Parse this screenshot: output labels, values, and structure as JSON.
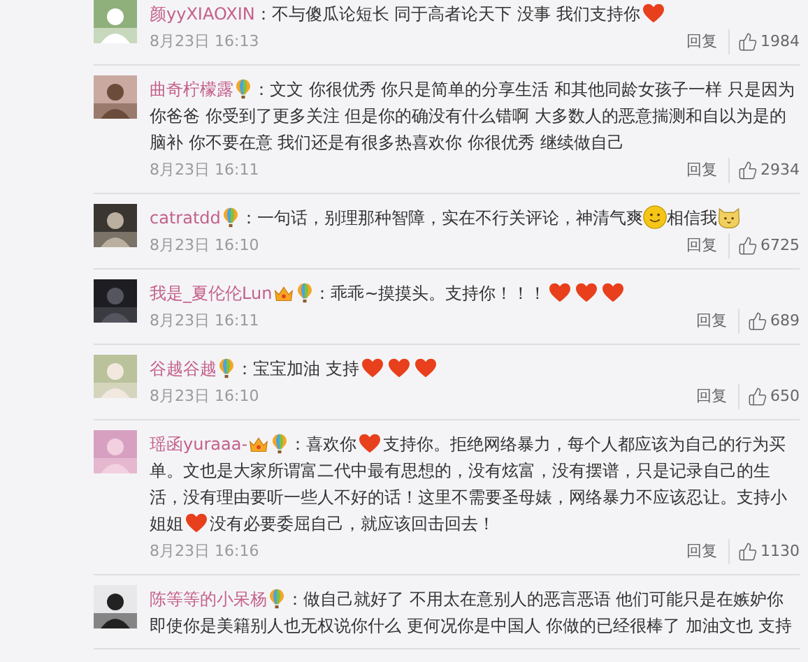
{
  "comments": [
    {
      "user": "颜yyXIAOXIN",
      "lines": [
        [
          {
            "kind": "text",
            "text": "：不与傻瓜论短长 同于高者论天下 没事 我们支持你"
          },
          {
            "kind": "heart"
          }
        ]
      ],
      "date": "8月23日 16:13",
      "reply": "回复",
      "likes": "1984"
    },
    {
      "user": "曲奇柠檬露",
      "badges": [
        {
          "kind": "balloon"
        }
      ],
      "lines": [
        [
          {
            "kind": "text",
            "text": "：文文 你很优秀 你只是简单的分享生活 和其他同龄女孩子一样 只是因为"
          }
        ],
        [
          {
            "kind": "text",
            "text": "你爸爸 你受到了更多关注 但是你的确没有什么错啊 大多数人的恶意揣测和自以为是的"
          }
        ],
        [
          {
            "kind": "text",
            "text": "脑补 你不要在意 我们还是有很多热喜欢你 你很优秀 继续做自己"
          }
        ]
      ],
      "date": "8月23日 16:11",
      "reply": "回复",
      "likes": "2934"
    },
    {
      "user": "catratdd",
      "badges": [
        {
          "kind": "balloon"
        }
      ],
      "lines": [
        [
          {
            "kind": "text",
            "text": "：一句话，别理那种智障，实在不行关评论，神清气爽"
          },
          {
            "kind": "smile"
          },
          {
            "kind": "text",
            "text": "相信我"
          },
          {
            "kind": "cat"
          }
        ]
      ],
      "date": "8月23日 16:10",
      "reply": "回复",
      "likes": "6725"
    },
    {
      "user": "我是_夏伦伦Lun",
      "badges": [
        {
          "kind": "vip"
        },
        {
          "kind": "balloon"
        }
      ],
      "lines": [
        [
          {
            "kind": "text",
            "text": "：乖乖~摸摸头。支持你！！！"
          },
          {
            "kind": "heart"
          },
          {
            "kind": "heart"
          },
          {
            "kind": "heart"
          }
        ]
      ],
      "date": "8月23日 16:11",
      "reply": "回复",
      "likes": "689"
    },
    {
      "user": "谷越谷越",
      "badges": [
        {
          "kind": "balloon"
        }
      ],
      "lines": [
        [
          {
            "kind": "text",
            "text": "：宝宝加油 支持"
          },
          {
            "kind": "heart"
          },
          {
            "kind": "heart"
          },
          {
            "kind": "heart"
          }
        ]
      ],
      "date": "8月23日 16:10",
      "reply": "回复",
      "likes": "650"
    },
    {
      "user": "瑶函yuraaa-",
      "badges": [
        {
          "kind": "vip"
        },
        {
          "kind": "balloon"
        }
      ],
      "lines": [
        [
          {
            "kind": "text",
            "text": "：喜欢你"
          },
          {
            "kind": "heart"
          },
          {
            "kind": "text",
            "text": "支持你。拒绝网络暴力，每个人都应该为自己的行为买"
          }
        ],
        [
          {
            "kind": "text",
            "text": "单。文也是大家所谓富二代中最有思想的，没有炫富，没有摆谱，只是记录自己的生"
          }
        ],
        [
          {
            "kind": "text",
            "text": "活，没有理由要听一些人不好的话！这里不需要圣母婊，网络暴力不应该忍让。支持小"
          }
        ],
        [
          {
            "kind": "text",
            "text": "姐姐"
          },
          {
            "kind": "heart"
          },
          {
            "kind": "text",
            "text": "没有必要委屈自己，就应该回击回去！"
          }
        ]
      ],
      "date": "8月23日 16:16",
      "reply": "回复",
      "likes": "1130"
    },
    {
      "user": "陈等等的小呆杨",
      "badges": [
        {
          "kind": "balloon"
        }
      ],
      "lines": [
        [
          {
            "kind": "text",
            "text": "：做自己就好了 不用太在意别人的恶言恶语 他们可能只是在嫉妒你"
          }
        ],
        [
          {
            "kind": "text",
            "text": "即使你是美籍别人也无权说你什么 更何况你是中国人 你做的已经很棒了 加油文也 支持"
          }
        ]
      ]
    }
  ]
}
